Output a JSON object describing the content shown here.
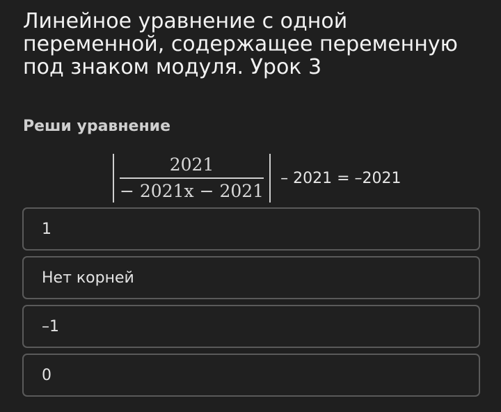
{
  "lesson": {
    "title": "Линейное уравнение с одной переменной, содержащее переменную под знаком модуля. Урок 3"
  },
  "task": {
    "prompt": "Реши уравнение",
    "equation": {
      "numerator": "2021",
      "denominator": "− 2021x − 2021",
      "rhs": "– 2021 = –2021"
    }
  },
  "options": [
    "1",
    "Нет корней",
    "–1",
    "0"
  ]
}
